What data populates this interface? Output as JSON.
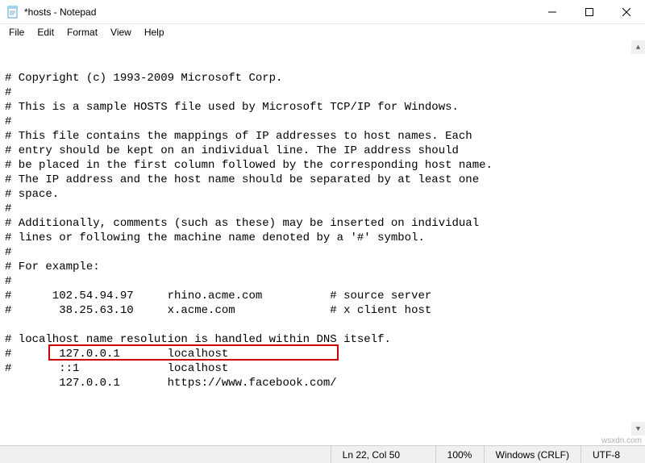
{
  "window": {
    "title": "*hosts - Notepad"
  },
  "menu": {
    "file": "File",
    "edit": "Edit",
    "format": "Format",
    "view": "View",
    "help": "Help"
  },
  "content": {
    "lines": [
      "# Copyright (c) 1993-2009 Microsoft Corp.",
      "#",
      "# This is a sample HOSTS file used by Microsoft TCP/IP for Windows.",
      "#",
      "# This file contains the mappings of IP addresses to host names. Each",
      "# entry should be kept on an individual line. The IP address should",
      "# be placed in the first column followed by the corresponding host name.",
      "# The IP address and the host name should be separated by at least one",
      "# space.",
      "#",
      "# Additionally, comments (such as these) may be inserted on individual",
      "# lines or following the machine name denoted by a '#' symbol.",
      "#",
      "# For example:",
      "#",
      "#      102.54.94.97     rhino.acme.com          # source server",
      "#       38.25.63.10     x.acme.com              # x client host",
      "",
      "# localhost name resolution is handled within DNS itself.",
      "#       127.0.0.1       localhost",
      "#       ::1             localhost",
      "        127.0.0.1       https://www.facebook.com/"
    ]
  },
  "status": {
    "position": "Ln 22, Col 50",
    "zoom": "100%",
    "line_ending": "Windows (CRLF)",
    "encoding": "UTF-8"
  },
  "watermark": "wsxdn.com"
}
